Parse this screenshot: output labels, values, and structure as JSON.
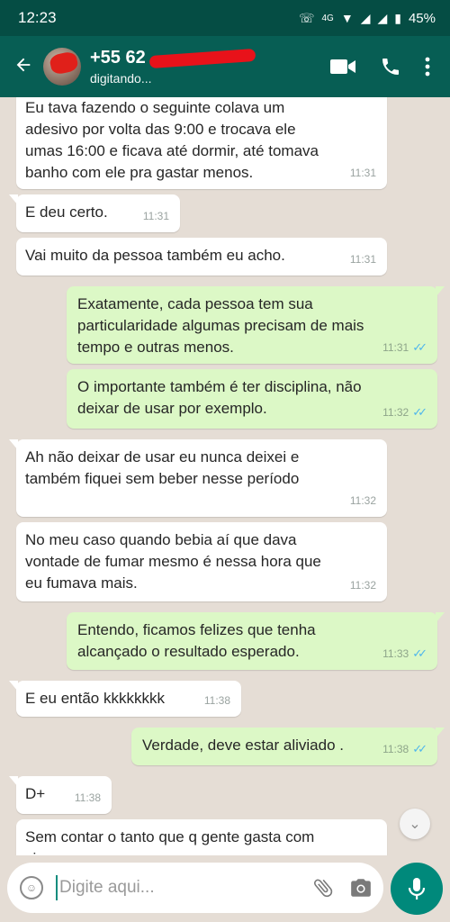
{
  "status_bar": {
    "time": "12:23",
    "network": "4G",
    "battery": "45%"
  },
  "header": {
    "contact_name": "+55 62",
    "contact_status": "digitando...",
    "icons": [
      "back-arrow-icon",
      "video-call-icon",
      "phone-icon",
      "more-vert-icon"
    ]
  },
  "messages": [
    {
      "dir": "in",
      "text": "Eu tava fazendo o seguinte colava um\nadesivo por volta das 9:00 e trocava ele\numas 16:00 e ficava até dormir, até tomava\nbanho com ele pra gastar menos.",
      "time": "11:31"
    },
    {
      "dir": "in",
      "text": "E deu certo.",
      "time": "11:31"
    },
    {
      "dir": "in",
      "text": "Vai muito da pessoa também eu acho.",
      "time": "11:31"
    },
    {
      "dir": "out",
      "text": "Exatamente, cada pessoa tem sua\nparticularidade algumas precisam de mais\ntempo e outras menos.",
      "time": "11:31",
      "read": true
    },
    {
      "dir": "out",
      "text": "O importante também é ter disciplina, não\ndeixar de usar por exemplo.",
      "time": "11:32",
      "read": true
    },
    {
      "dir": "in",
      "text": "Ah não deixar de usar eu nunca deixei e\ntambém fiquei sem beber nesse período",
      "time": "11:32"
    },
    {
      "dir": "in",
      "text": "No meu caso quando bebia aí que dava\nvontade de fumar mesmo é nessa hora que\neu fumava mais.",
      "time": "11:32"
    },
    {
      "dir": "out",
      "text": "Entendo, ficamos felizes que tenha\nalcançado o resultado esperado.",
      "time": "11:33",
      "read": true
    },
    {
      "dir": "in",
      "text": "E eu então kkkkkkkk",
      "time": "11:38"
    },
    {
      "dir": "out",
      "text": "Verdade, deve estar aliviado .",
      "time": "11:38",
      "read": true
    },
    {
      "dir": "in",
      "text": "D+",
      "time": "11:38"
    },
    {
      "dir": "in",
      "text": "Sem contar o tanto que q gente gasta com\ncigarro",
      "time": ""
    }
  ],
  "input": {
    "placeholder": "Digite aqui..."
  },
  "colors": {
    "header": "#075e54",
    "status_bar": "#054d44",
    "outgoing_bubble": "#dcf8c6",
    "incoming_bubble": "#ffffff",
    "chat_bg": "#e5ddd5",
    "accent": "#00897b",
    "read_ticks": "#4fb6ec"
  }
}
